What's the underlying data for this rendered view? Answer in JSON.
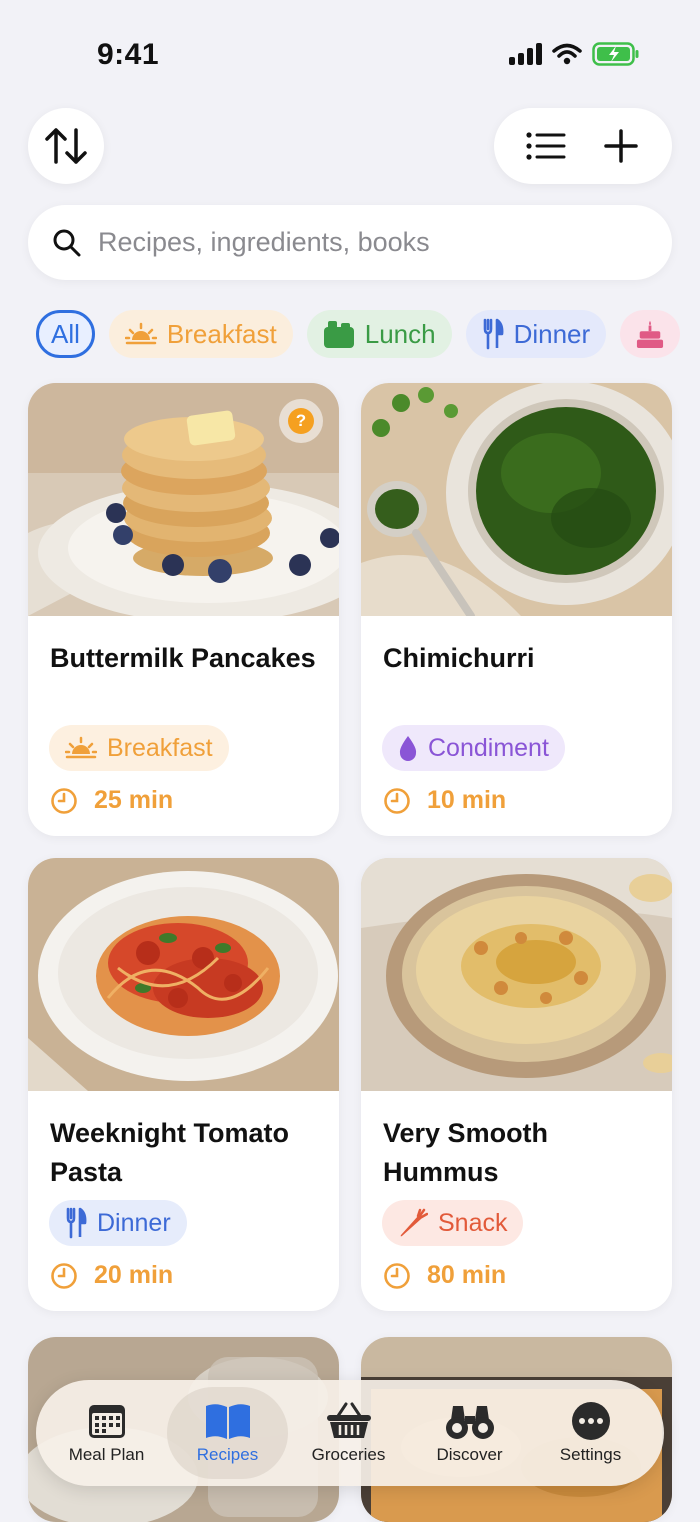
{
  "status": {
    "time": "9:41"
  },
  "search": {
    "placeholder": "Recipes, ingredients, books"
  },
  "chips": [
    {
      "label": "All"
    },
    {
      "label": "Breakfast"
    },
    {
      "label": "Lunch"
    },
    {
      "label": "Dinner"
    },
    {
      "label": ""
    }
  ],
  "recipes": [
    {
      "title": "Buttermilk Pancakes",
      "category": "Breakfast",
      "time": "25 min"
    },
    {
      "title": "Chimichurri",
      "category": "Condiment",
      "time": "10 min"
    },
    {
      "title": "Weeknight Tomato Pasta",
      "category": "Dinner",
      "time": "20 min"
    },
    {
      "title": "Very Smooth Hummus",
      "category": "Snack",
      "time": "80 min"
    }
  ],
  "tabs": [
    {
      "label": "Meal Plan",
      "icon": "calendar-icon"
    },
    {
      "label": "Recipes",
      "icon": "book-icon"
    },
    {
      "label": "Groceries",
      "icon": "basket-icon"
    },
    {
      "label": "Discover",
      "icon": "binoculars-icon"
    },
    {
      "label": "Settings",
      "icon": "more-icon"
    }
  ],
  "colors": {
    "accent": "#2f6fe0",
    "time": "#f0a03a",
    "background": "#f2f2f7"
  }
}
